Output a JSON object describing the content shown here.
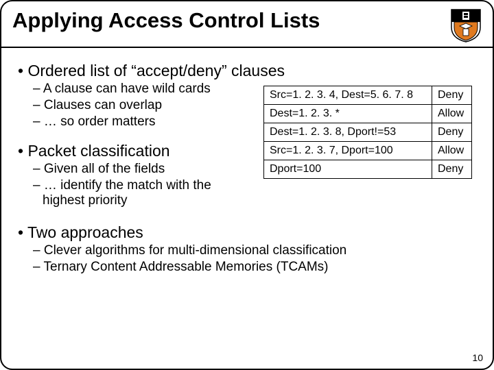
{
  "title": "Applying Access Control Lists",
  "page_number": "10",
  "bullets": {
    "b1": "Ordered list of “accept/deny” clauses",
    "b1_subs": {
      "s1": "A clause can have wild cards",
      "s2": "Clauses can overlap",
      "s3": "… so order matters"
    },
    "b2": "Packet classification",
    "b2_subs": {
      "s1": "Given all of the fields",
      "s2": "… identify the match with the highest priority"
    },
    "b3": "Two approaches",
    "b3_subs": {
      "s1": "Clever algorithms for multi-dimensional classification",
      "s2": "Ternary Content Addressable Memories (TCAMs)"
    }
  },
  "acl_table": [
    {
      "rule": "Src=1. 2. 3. 4, Dest=5. 6. 7. 8",
      "action": "Deny"
    },
    {
      "rule": "Dest=1. 2. 3. *",
      "action": "Allow"
    },
    {
      "rule": "Dest=1. 2. 3. 8, Dport!=53",
      "action": "Deny"
    },
    {
      "rule": "Src=1. 2. 3. 7, Dport=100",
      "action": "Allow"
    },
    {
      "rule": "Dport=100",
      "action": "Deny"
    }
  ]
}
